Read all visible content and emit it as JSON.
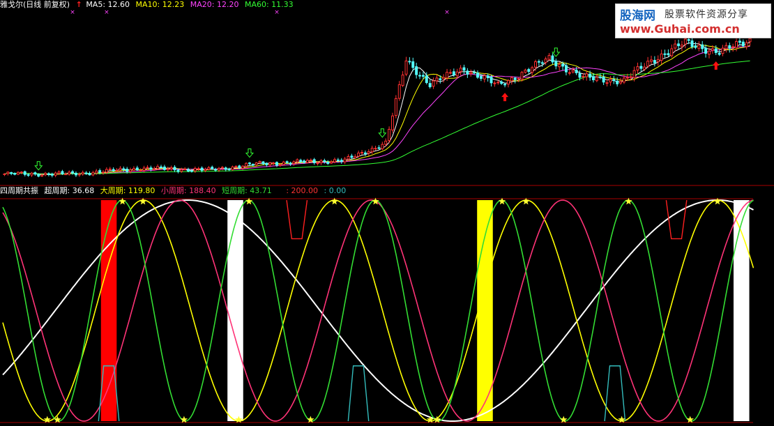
{
  "header": {
    "name": "雅戈尔(日线 前复权)",
    "ma": [
      {
        "label": "MA5: 12.60",
        "color": "#ffffff"
      },
      {
        "label": "MA10: 12.23",
        "color": "#ffff00"
      },
      {
        "label": "MA20: 12.20",
        "color": "#ff44ff"
      },
      {
        "label": "MA60: 11.33",
        "color": "#33ff33"
      }
    ]
  },
  "indicator": {
    "name": "四周期共振",
    "items": [
      {
        "label": "超周期: 36.68",
        "color": "#ffffff"
      },
      {
        "label": "大周期: 119.80",
        "color": "#ffff00"
      },
      {
        "label": "小周期: 188.40",
        "color": "#ff3377"
      },
      {
        "label": "短周期: 43.71",
        "color": "#33dd33"
      },
      {
        "label": ": 200.00",
        "color": "#ff3333"
      },
      {
        "label": ": 0.00",
        "color": "#33bbbb"
      }
    ]
  },
  "watermark": {
    "brand": "股海网",
    "slogan": "股票软件资源分享",
    "url": "www.Guhai.com.cn"
  },
  "chart_data": [
    {
      "type": "candlestick",
      "title": "雅戈尔(日线 前复权)",
      "ylim": [
        6.8,
        17.5
      ],
      "x_count": 220,
      "candles": {
        "segments": [
          {
            "end": 20,
            "price": 7.35
          },
          {
            "end": 40,
            "price": 7.7
          },
          {
            "end": 60,
            "price": 7.6
          },
          {
            "end": 75,
            "price": 8.0
          },
          {
            "end": 100,
            "price": 8.2
          },
          {
            "end": 112,
            "price": 9.3
          },
          {
            "end": 118,
            "price": 14.5
          },
          {
            "end": 125,
            "price": 13.0
          },
          {
            "end": 135,
            "price": 14.0
          },
          {
            "end": 145,
            "price": 12.9
          },
          {
            "end": 160,
            "price": 14.6
          },
          {
            "end": 170,
            "price": 13.4
          },
          {
            "end": 182,
            "price": 13.2
          },
          {
            "end": 190,
            "price": 14.5
          },
          {
            "end": 200,
            "price": 15.6
          },
          {
            "end": 210,
            "price": 15.0
          },
          {
            "end": 219,
            "price": 15.8
          }
        ]
      },
      "series": [
        {
          "name": "MA5",
          "value": 12.6,
          "color": "#ffffff"
        },
        {
          "name": "MA10",
          "value": 12.23,
          "color": "#ffff00"
        },
        {
          "name": "MA20",
          "value": 12.2,
          "color": "#ff44ff"
        },
        {
          "name": "MA60",
          "value": 11.33,
          "color": "#33ff33"
        }
      ],
      "signals": [
        {
          "type": "up-arrow",
          "x": 147
        },
        {
          "type": "up-arrow",
          "x": 209
        },
        {
          "type": "down-arrow",
          "x": 10
        },
        {
          "type": "down-arrow",
          "x": 72
        },
        {
          "type": "down-arrow",
          "x": 111
        },
        {
          "type": "down-arrow",
          "x": 162
        }
      ]
    },
    {
      "type": "line",
      "title": "四周期共振",
      "ylim": [
        0,
        200
      ],
      "x_count": 220,
      "series": [
        {
          "name": "超周期",
          "color": "#ffffff",
          "period": 155,
          "phase": -0.62
        },
        {
          "name": "大周期",
          "color": "#ffff00",
          "period": 56,
          "phase": 3.25
        },
        {
          "name": "小周期",
          "color": "#ff3377",
          "period": 56,
          "phase": 2.05
        },
        {
          "name": "短周期",
          "color": "#33dd33",
          "period": 37,
          "phase": 1.93
        }
      ],
      "bars": [
        {
          "x": 31,
          "color": "#ff0000"
        },
        {
          "x": 68,
          "color": "#ffffff"
        },
        {
          "x": 141,
          "color": "#ffff00"
        },
        {
          "x": 216,
          "color": "#ffffff"
        }
      ],
      "pulses_high": [
        86,
        197
      ],
      "pulses_low": [
        31,
        104,
        179
      ]
    }
  ]
}
